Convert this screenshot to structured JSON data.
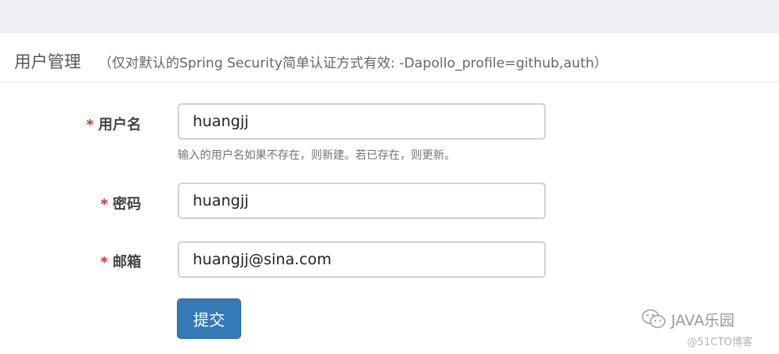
{
  "panel": {
    "title": "用户管理",
    "hint": "（仅对默认的Spring Security简单认证方式有效: -Dapollo_profile=github,auth）"
  },
  "form": {
    "required_mark": "*",
    "username": {
      "label": "用户名",
      "value": "huangjj",
      "help": "输入的用户名如果不存在，则新建。若已存在，则更新。"
    },
    "password": {
      "label": "密码",
      "value": "huangjj"
    },
    "email": {
      "label": "邮箱",
      "value": "huangjj@sina.com"
    },
    "submit_label": "提交"
  },
  "watermark": {
    "icon": "wechat-icon",
    "text": "JAVA乐园",
    "sub": "@51CTO博客"
  },
  "colors": {
    "primary_button": "#337ab7",
    "required": "#cc3333"
  }
}
